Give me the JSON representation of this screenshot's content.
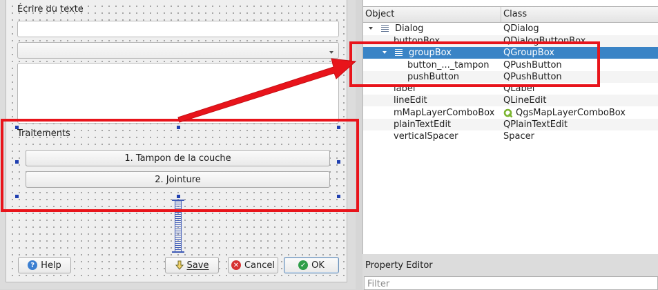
{
  "form": {
    "label_text": "Écrire du texte",
    "line_edit_value": "",
    "combo_value": "",
    "plain_text_value": "",
    "group_title": "Traitements",
    "button_tampon": "1. Tampon de la couche",
    "button_jointure": "2. Jointure",
    "help_button": "Help",
    "save_button": "Save",
    "cancel_button": "Cancel",
    "ok_button": "OK"
  },
  "inspector": {
    "columns": [
      "Object",
      "Class"
    ],
    "rows": [
      {
        "object": "Dialog",
        "class": "QDialog",
        "icon": "layout-icon"
      },
      {
        "object": "buttonBox",
        "class": "QDialogButtonBox"
      },
      {
        "object": "groupBox",
        "class": "QGroupBox",
        "icon": "layout-icon",
        "selected": true
      },
      {
        "object": "button_..._tampon",
        "class": "QPushButton"
      },
      {
        "object": "pushButton",
        "class": "QPushButton"
      },
      {
        "object": "label",
        "class": "QLabel"
      },
      {
        "object": "lineEdit",
        "class": "QLineEdit"
      },
      {
        "object": "mMapLayerComboBox",
        "class": "QgsMapLayerComboBox",
        "class_icon": "qgis-icon"
      },
      {
        "object": "plainTextEdit",
        "class": "QPlainTextEdit"
      },
      {
        "object": "verticalSpacer",
        "class": "Spacer"
      }
    ]
  },
  "property_editor": {
    "title": "Property Editor",
    "filter_placeholder": "Filter"
  },
  "colors": {
    "annotation_red": "#e8141b",
    "selection_blue": "#3a84c6",
    "handle_blue": "#1f3fb0",
    "qgis_green": "#7bb52f"
  }
}
